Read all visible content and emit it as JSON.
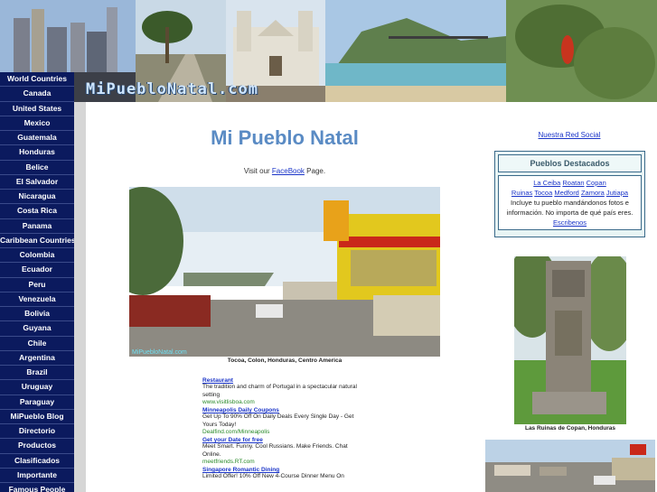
{
  "header": {
    "site_title": "MiPuebloNatal.com"
  },
  "nav": {
    "items": [
      "World Countries",
      "Canada",
      "United States",
      "Mexico",
      "Guatemala",
      "Honduras",
      "Belice",
      "El Salvador",
      "Nicaragua",
      "Costa Rica",
      "Panama",
      "Caribbean Countries",
      "Colombia",
      "Ecuador",
      "Peru",
      "Venezuela",
      "Bolivia",
      "Guyana",
      "Chile",
      "Argentina",
      "Brazil",
      "Uruguay",
      "Paraguay",
      "MiPueblo Blog",
      "Directorio",
      "Productos",
      "Clasificados",
      "Importante",
      "Famous People"
    ]
  },
  "main": {
    "title": "Mi Pueblo Natal",
    "visit_prefix": "Visit our ",
    "visit_link": "FaceBook",
    "visit_suffix": " Page.",
    "photo_caption": "Tocoa, Colon, Honduras, Centro America",
    "photo_watermark": "MiPuebloNatal.com"
  },
  "ads": [
    {
      "title": "Restaurant",
      "text": "The tradition and charm of Portugal in a spectacular natural setting",
      "url": "www.visitlisboa.com"
    },
    {
      "title": "Minneapolis Daily Coupons",
      "text": "Get Up To 90% Off On Daily Deals Every Single Day - Get Yours Today!",
      "url": "Dealfind.com/Minneapolis"
    },
    {
      "title": "Get your Date for free",
      "text": "Meet Smart. Funny. Cool Russians. Make Friends. Chat Online.",
      "url": "meetfriends.RT.com"
    },
    {
      "title": "Singapore Romantic Dining",
      "text": "Limited Offer! 10% Off New 4-Course Dinner Menu On",
      "url": ""
    }
  ],
  "sidebar": {
    "social_link": "Nuestra Red Social",
    "featured_title": "Pueblos Destacados",
    "featured_links_row1": [
      "La Ceiba",
      "Roatan",
      "Copan"
    ],
    "featured_links_row2": [
      "Ruinas",
      "Tocoa",
      "Medford",
      "Zamora",
      "Jutiapa"
    ],
    "featured_text": "Incluye tu pueblo mandándonos fotos e información. No importa de qué país eres.",
    "featured_contact": "Escribenos",
    "statue_caption": "Las Ruinas de Copan, Honduras"
  },
  "colors": {
    "nav_bg": "#0b1a5e",
    "title": "#5a8bc4",
    "link": "#1a34c8",
    "box_border": "#3a6a8a"
  }
}
